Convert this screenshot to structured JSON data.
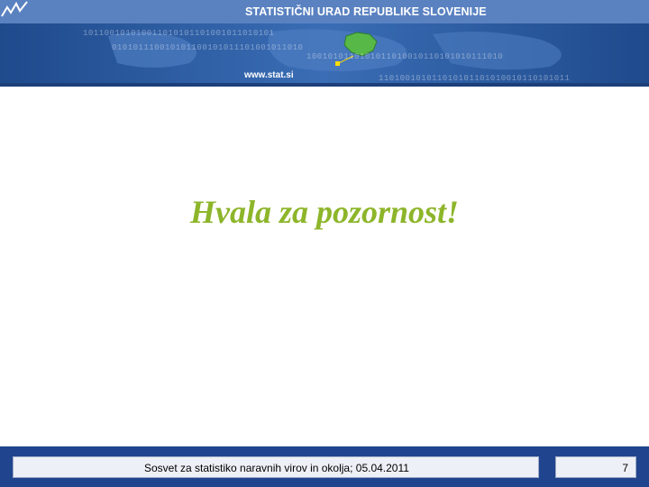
{
  "header": {
    "org_name": "STATISTIČNI URAD REPUBLIKE SLOVENIJE",
    "url": "www.stat.si",
    "binary_rows": [
      "101100101010011010101101001011010101",
      "010101110010101100101011101001011010",
      "1001010110101011010010110101010111010",
      "110100101011010101101010010110101011"
    ],
    "logo_icon": "stat-chart-icon",
    "colors": {
      "band": "#2b5ba5",
      "dark_band": "#1d3f7a",
      "highlight": "#57b848"
    }
  },
  "slide": {
    "title": "Hvala za pozornost!",
    "title_color": "#8db52a"
  },
  "footer": {
    "text": "Sosvet za statistiko naravnih virov in okolja; 05.04.2011",
    "page_number": "7",
    "color": "#20458e"
  }
}
